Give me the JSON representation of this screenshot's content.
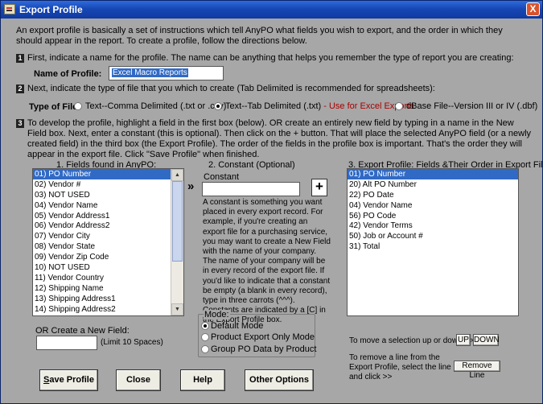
{
  "window": {
    "title": "Export Profile",
    "close_label": "X"
  },
  "intro": "An export profile is basically a set of instructions which tell AnyPO what fields you wish to export, and the order in which they should appear in the report.  To create a profile, follow the directions below.",
  "step1": {
    "number": "1",
    "text": "First, indicate a name for the profile.  The name can be anything that helps you remember the type of report you are creating:",
    "label": "Name of Profile:",
    "value": "Excel Macro Reports"
  },
  "step2": {
    "number": "2",
    "text": "Next, indicate the type of file that you which to create (Tab Delimited is recommended for spreadsheets):",
    "label": "Type of File:",
    "options": [
      {
        "label": "Text--Comma Delimited (.txt or .csv)",
        "selected": false
      },
      {
        "label": "Text--Tab Delimited (.txt)",
        "note": " - Use for Excel Exports",
        "selected": true
      },
      {
        "label": "dBase File--Version III or IV (.dbf)",
        "selected": false
      }
    ]
  },
  "step3": {
    "number": "3",
    "text": "To develop the profile, highlight a field in the first box (below).  OR create an entirely new field by typing in a name in the New Field box.  Next, enter a constant (this is optional).  Then click on the + button.  That will place the selected AnyPO field (or a newly created field) in the third box (the Export Profile).  The order of the fields in the profile box is important.  That's the order they will appear in the export file.  Click \"Save Profile\" when finished."
  },
  "fields": {
    "header": "1. Fields found in AnyPO:",
    "items": [
      "01) PO Number",
      "02) Vendor #",
      "03) NOT USED",
      "04) Vendor Name",
      "05) Vendor Address1",
      "06) Vendor Address2",
      "07) Vendor City",
      "08) Vendor State",
      "09) Vendor Zip Code",
      "10) NOT USED",
      "11) Vendor Country",
      "12) Shipping Name",
      "13) Shipping Address1",
      "14) Shipping Address2"
    ],
    "selected_index": 0
  },
  "arrows": "»",
  "constant": {
    "header": "2. Constant (Optional)",
    "label": "Constant",
    "value": "",
    "add_label": "+",
    "help": "A constant is something you want placed in every export record.  For example, if you're creating an export file for a purchasing service, you may want to create a New Field with the name of your company.  The name of your company will be in every record of the export file.  If you'd like to indicate that a constant be empty (a blank in every record), type in three carrots (^^^).  Constants are indicated by a [C] in the Export Profile box."
  },
  "profile": {
    "header": "3. Export Profile:  Fields &Their Order in Export File:",
    "items": [
      "01) PO Number",
      "20) Alt PO Number",
      "22) PO Date",
      "04) Vendor Name",
      "56) PO Code",
      "42) Vendor Terms",
      "50) Job or Account #",
      "31) Total"
    ],
    "selected_index": 0
  },
  "new_field": {
    "label": "OR Create a New Field:",
    "value": "",
    "hint": "(Limit 10 Spaces)"
  },
  "mode": {
    "label": "Mode:",
    "options": [
      {
        "label": "Default Mode",
        "selected": true
      },
      {
        "label": "Product Export Only Mode",
        "selected": false
      },
      {
        "label": "Group PO Data by Product",
        "selected": false
      }
    ]
  },
  "move": {
    "text": "To move a selection up or down >>",
    "up_label": "UP",
    "down_label": "DOWN"
  },
  "remove": {
    "text": "To remove a line from the Export Profile, select the line and click >>",
    "button_label": "Remove Line"
  },
  "buttons": {
    "save": "Save Profile",
    "close": "Close",
    "help": "Help",
    "other": "Other Options"
  }
}
